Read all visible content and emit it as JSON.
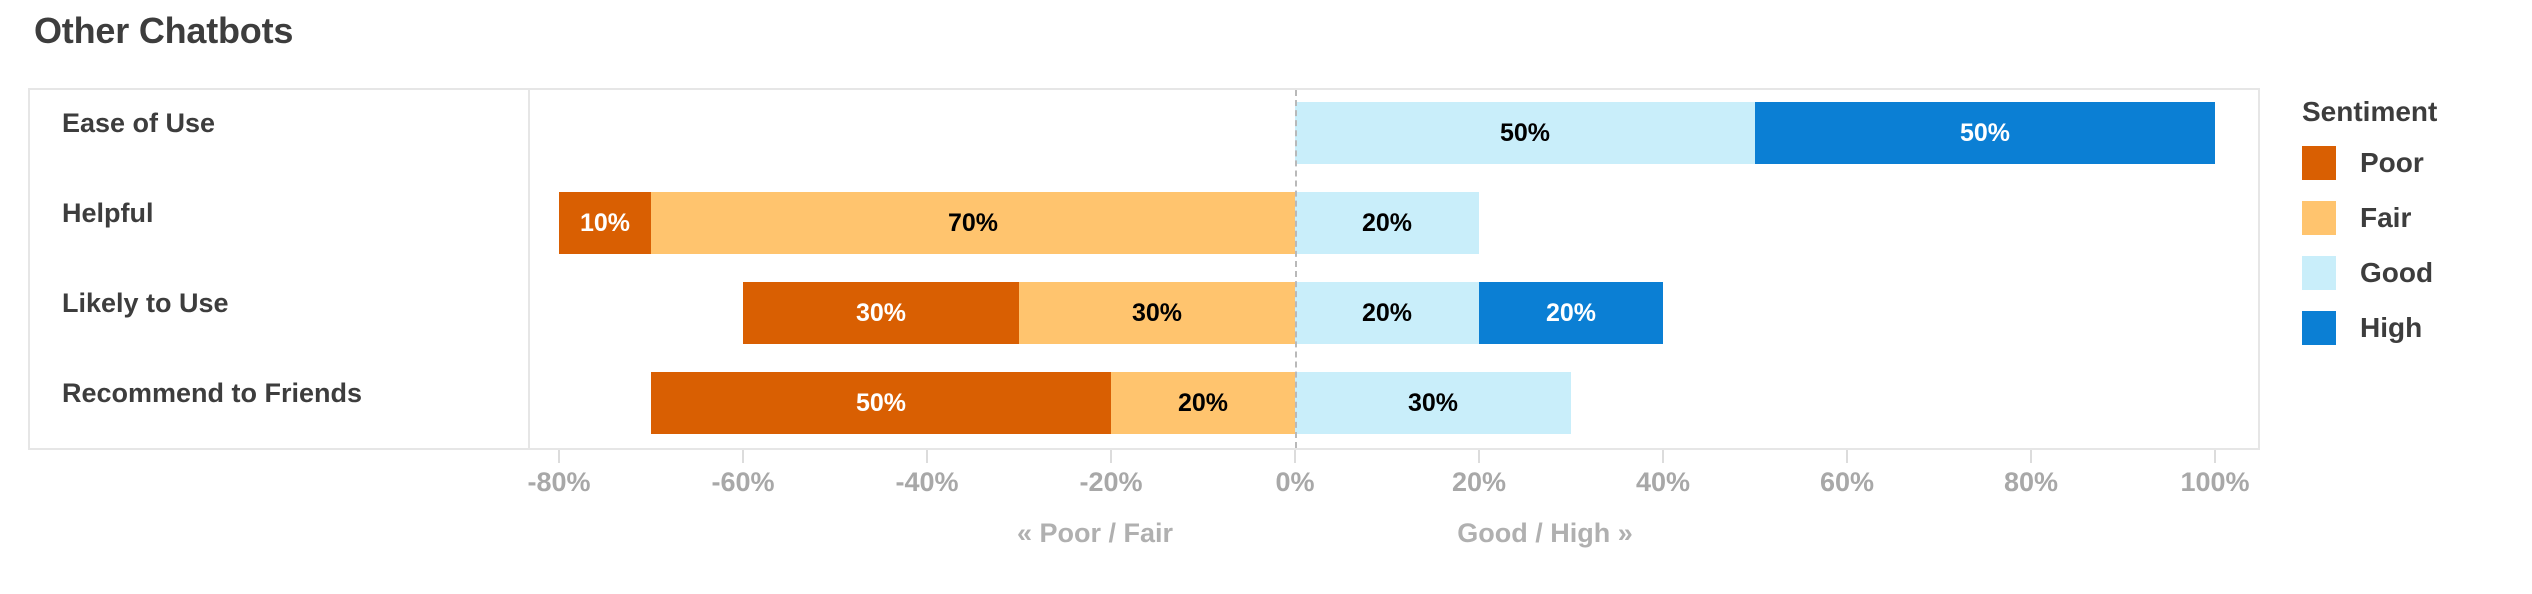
{
  "chart_data": {
    "type": "bar",
    "subtype": "diverging-stacked-bar",
    "title": "Other Chatbots",
    "xlabel": "",
    "ylabel": "",
    "xlim": [
      -80,
      100
    ],
    "x_ticks": [
      "-80%",
      "-60%",
      "-40%",
      "-20%",
      "0%",
      "20%",
      "40%",
      "60%",
      "80%",
      "100%"
    ],
    "x_tick_values": [
      -80,
      -60,
      -40,
      -20,
      0,
      20,
      40,
      60,
      80,
      100
    ],
    "grid": false,
    "legend_position": "right",
    "legend_title": "Sentiment",
    "categories": [
      "Ease of Use",
      "Helpful",
      "Likely to Use",
      "Recommend to Friends"
    ],
    "series": [
      {
        "name": "Poor",
        "color": "#d95f02",
        "values": [
          0,
          10,
          30,
          50
        ]
      },
      {
        "name": "Fair",
        "color": "#ffc46e",
        "values": [
          0,
          70,
          30,
          20
        ]
      },
      {
        "name": "Good",
        "color": "#c9eefa",
        "values": [
          50,
          20,
          20,
          30
        ]
      },
      {
        "name": "High",
        "color": "#0b7fd4",
        "values": [
          50,
          0,
          20,
          0
        ]
      }
    ],
    "annotations": {
      "left_axis_note": "« Poor / Fair",
      "right_axis_note": "Good / High »"
    }
  },
  "title": "Other Chatbots",
  "rows": [
    {
      "label": "Ease of Use",
      "segments": [
        {
          "series": "Good",
          "value": 50,
          "label": "50%",
          "color": "#c9eefa",
          "text_color": "#000000"
        },
        {
          "series": "High",
          "value": 50,
          "label": "50%",
          "color": "#0b7fd4",
          "text_color": "#ffffff"
        }
      ]
    },
    {
      "label": "Helpful",
      "segments": [
        {
          "series": "Poor",
          "value": 10,
          "label": "10%",
          "color": "#d95f02",
          "text_color": "#ffffff"
        },
        {
          "series": "Fair",
          "value": 70,
          "label": "70%",
          "color": "#ffc46e",
          "text_color": "#000000"
        },
        {
          "series": "Good",
          "value": 20,
          "label": "20%",
          "color": "#c9eefa",
          "text_color": "#000000"
        }
      ]
    },
    {
      "label": "Likely to Use",
      "segments": [
        {
          "series": "Poor",
          "value": 30,
          "label": "30%",
          "color": "#d95f02",
          "text_color": "#ffffff"
        },
        {
          "series": "Fair",
          "value": 30,
          "label": "30%",
          "color": "#ffc46e",
          "text_color": "#000000"
        },
        {
          "series": "Good",
          "value": 20,
          "label": "20%",
          "color": "#c9eefa",
          "text_color": "#000000"
        },
        {
          "series": "High",
          "value": 20,
          "label": "20%",
          "color": "#0b7fd4",
          "text_color": "#ffffff"
        }
      ]
    },
    {
      "label": "Recommend to Friends",
      "segments": [
        {
          "series": "Poor",
          "value": 50,
          "label": "50%",
          "color": "#d95f02",
          "text_color": "#ffffff"
        },
        {
          "series": "Fair",
          "value": 20,
          "label": "20%",
          "color": "#ffc46e",
          "text_color": "#000000"
        },
        {
          "series": "Good",
          "value": 30,
          "label": "30%",
          "color": "#c9eefa",
          "text_color": "#000000"
        }
      ]
    }
  ],
  "axis": {
    "ticks": [
      "-80%",
      "-60%",
      "-40%",
      "-20%",
      "0%",
      "20%",
      "40%",
      "60%",
      "80%",
      "100%"
    ],
    "tick_values": [
      -80,
      -60,
      -40,
      -20,
      0,
      20,
      40,
      60,
      80,
      100
    ],
    "left_note": "« Poor / Fair",
    "right_note": "Good / High »"
  },
  "legend": {
    "title": "Sentiment",
    "items": [
      {
        "label": "Poor",
        "color": "#d95f02"
      },
      {
        "label": "Fair",
        "color": "#ffc46e"
      },
      {
        "label": "Good",
        "color": "#c9eefa"
      },
      {
        "label": "High",
        "color": "#0b7fd4"
      }
    ]
  },
  "colors": {
    "poor": "#d95f02",
    "fair": "#ffc46e",
    "good": "#c9eefa",
    "high": "#0b7fd4",
    "text": "#3d3d3d",
    "axis_text": "#a8a8a8",
    "frame": "#e6e6e6"
  }
}
